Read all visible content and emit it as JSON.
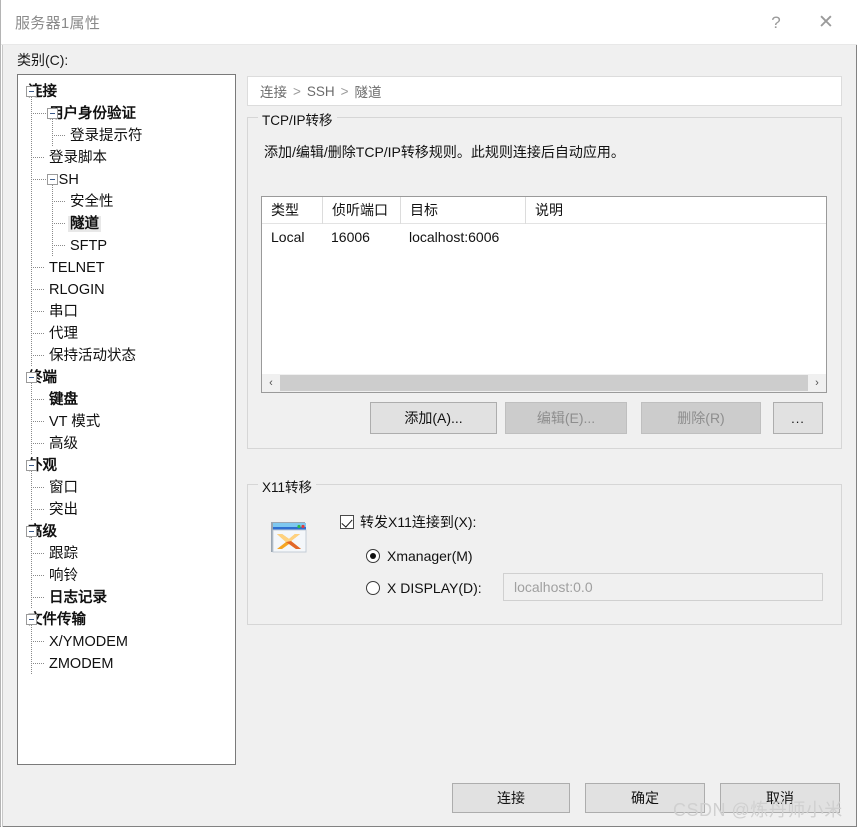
{
  "window": {
    "title": "服务器1属性",
    "help_label": "?",
    "close_label": "✕"
  },
  "sidebar": {
    "label": "类别(C):",
    "items": [
      {
        "label": "连接",
        "level": 0,
        "bold": true,
        "expander": true,
        "selected": false
      },
      {
        "label": "用户身份验证",
        "level": 1,
        "bold": true,
        "expander": true,
        "selected": false
      },
      {
        "label": "登录提示符",
        "level": 2,
        "bold": false,
        "expander": false,
        "selected": false
      },
      {
        "label": "登录脚本",
        "level": 1,
        "bold": false,
        "expander": false,
        "selected": false
      },
      {
        "label": "SSH",
        "level": 1,
        "bold": false,
        "expander": true,
        "selected": false
      },
      {
        "label": "安全性",
        "level": 2,
        "bold": false,
        "expander": false,
        "selected": false
      },
      {
        "label": "隧道",
        "level": 2,
        "bold": true,
        "expander": false,
        "selected": true
      },
      {
        "label": "SFTP",
        "level": 2,
        "bold": false,
        "expander": false,
        "selected": false
      },
      {
        "label": "TELNET",
        "level": 1,
        "bold": false,
        "expander": false,
        "selected": false
      },
      {
        "label": "RLOGIN",
        "level": 1,
        "bold": false,
        "expander": false,
        "selected": false
      },
      {
        "label": "串口",
        "level": 1,
        "bold": false,
        "expander": false,
        "selected": false
      },
      {
        "label": "代理",
        "level": 1,
        "bold": false,
        "expander": false,
        "selected": false
      },
      {
        "label": "保持活动状态",
        "level": 1,
        "bold": false,
        "expander": false,
        "selected": false
      },
      {
        "label": "终端",
        "level": 0,
        "bold": true,
        "expander": true,
        "selected": false
      },
      {
        "label": "键盘",
        "level": 1,
        "bold": true,
        "expander": false,
        "selected": false
      },
      {
        "label": "VT 模式",
        "level": 1,
        "bold": false,
        "expander": false,
        "selected": false
      },
      {
        "label": "高级",
        "level": 1,
        "bold": false,
        "expander": false,
        "selected": false
      },
      {
        "label": "外观",
        "level": 0,
        "bold": true,
        "expander": true,
        "selected": false
      },
      {
        "label": "窗口",
        "level": 1,
        "bold": false,
        "expander": false,
        "selected": false
      },
      {
        "label": "突出",
        "level": 1,
        "bold": false,
        "expander": false,
        "selected": false
      },
      {
        "label": "高级",
        "level": 0,
        "bold": true,
        "expander": true,
        "selected": false
      },
      {
        "label": "跟踪",
        "level": 1,
        "bold": false,
        "expander": false,
        "selected": false
      },
      {
        "label": "响铃",
        "level": 1,
        "bold": false,
        "expander": false,
        "selected": false
      },
      {
        "label": "日志记录",
        "level": 1,
        "bold": true,
        "expander": false,
        "selected": false
      },
      {
        "label": "文件传输",
        "level": 0,
        "bold": true,
        "expander": true,
        "selected": false
      },
      {
        "label": "X/YMODEM",
        "level": 1,
        "bold": false,
        "expander": false,
        "selected": false
      },
      {
        "label": "ZMODEM",
        "level": 1,
        "bold": false,
        "expander": false,
        "selected": false
      }
    ]
  },
  "breadcrumb": {
    "part1": "连接",
    "sep1": ">",
    "part2": "SSH",
    "sep2": ">",
    "part3": "隧道"
  },
  "tcp_group": {
    "title": "TCP/IP转移",
    "description": "添加/编辑/删除TCP/IP转移规则。此规则连接后自动应用。",
    "columns": [
      "类型",
      "侦听端口",
      "目标",
      "说明"
    ],
    "rows": [
      {
        "type": "Local",
        "port": "16006",
        "target": "localhost:6006",
        "desc": ""
      }
    ],
    "buttons": {
      "add": "添加(A)...",
      "edit": "编辑(E)...",
      "delete": "删除(R)",
      "more": "..."
    },
    "scroll_left": "‹",
    "scroll_right": "›"
  },
  "x11_group": {
    "title": "X11转移",
    "icon": "xmanager-icon",
    "checkbox_label": "转发X11连接到(X):",
    "checkbox_checked": true,
    "radio_xmanager": "Xmanager(M)",
    "radio_xmanager_selected": true,
    "radio_xdisplay": "X DISPLAY(D):",
    "radio_xdisplay_selected": false,
    "display_value": "localhost:0.0"
  },
  "footer": {
    "connect": "连接",
    "ok": "确定",
    "cancel": "取消"
  },
  "watermark": "CSDN @炼丹师小米",
  "colors": {
    "dialog_bg": "#f0f0f0",
    "panel_white": "#ffffff",
    "button_bg": "#e1e1e1",
    "disabled_text": "#8e8e8e",
    "selection": "#e8e8e8",
    "scroll_thumb": "#cdcdcd"
  }
}
